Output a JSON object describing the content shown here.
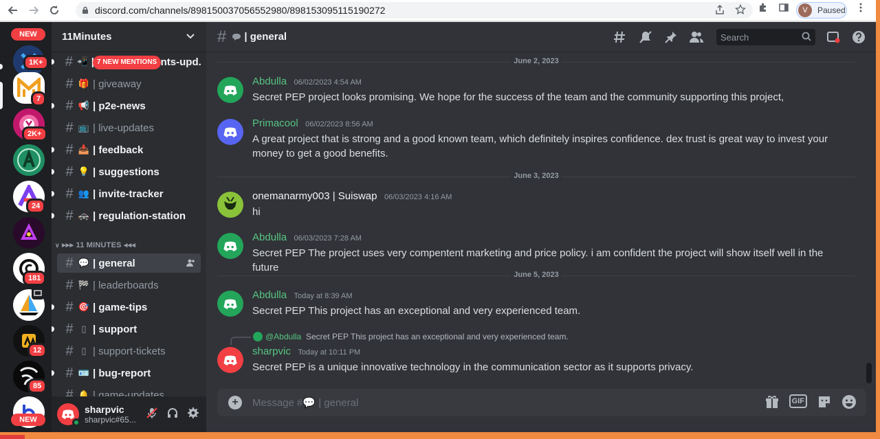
{
  "browser": {
    "url": "discord.com/channels/898150037056552980/898153095115190272",
    "profile_initial": "V",
    "profile_status": "Paused"
  },
  "servers": {
    "new_top": "NEW",
    "new_bottom": "NEW",
    "badges": [
      "1K+",
      "7",
      "2K+",
      "24",
      "181",
      "12",
      "85"
    ]
  },
  "guild": {
    "name": "11Minutes",
    "new_mentions": "7 NEW MENTIONS",
    "category": "▸▸▸ 11 MINUTES ◂◂◂",
    "channels": [
      {
        "name": "| announcements-upd...",
        "emoji": "📲",
        "state": "unread"
      },
      {
        "name": "| giveaway",
        "emoji": "🎁",
        "state": "read"
      },
      {
        "name": "| p2e-news",
        "emoji": "📢",
        "state": "unread"
      },
      {
        "name": "| live-updates",
        "emoji": "📺",
        "state": "read"
      },
      {
        "name": "| feedback",
        "emoji": "📥",
        "state": "unread"
      },
      {
        "name": "| suggestions",
        "emoji": "💡",
        "state": "unread"
      },
      {
        "name": "| invite-tracker",
        "emoji": "👥",
        "state": "unread"
      },
      {
        "name": "| regulation-station",
        "emoji": "🚓",
        "state": "unread"
      },
      {
        "name": "| general",
        "emoji": "💬",
        "state": "active"
      },
      {
        "name": "| leaderboards",
        "emoji": "🏁",
        "state": "read"
      },
      {
        "name": "| game-tips",
        "emoji": "🎯",
        "state": "unread"
      },
      {
        "name": "| support",
        "emoji": "▯",
        "state": "unread"
      },
      {
        "name": "| support-tickets",
        "emoji": "▯",
        "state": "read"
      },
      {
        "name": "| bug-report",
        "emoji": "🪪",
        "state": "unread"
      },
      {
        "name": "| game-updates",
        "emoji": "🔔",
        "state": "read"
      }
    ]
  },
  "user": {
    "display": "sharpvic",
    "tag": "sharpvic#65..."
  },
  "chat": {
    "channel_title": "| general",
    "search_placeholder": "Search",
    "composer_placeholder": "Message #💬 | general",
    "gif_label": "GIF",
    "dividers": [
      "June 2, 2023",
      "June 3, 2023",
      "June 5, 2023"
    ],
    "messages": [
      {
        "author": "Abdulla",
        "time": "06/02/2023 4:54 AM",
        "color": "#57c481",
        "avatar": "#23a55a",
        "body": "Secret PEP project looks promising. We hope for the success of the team and the community supporting this project,"
      },
      {
        "author": "Primacool",
        "time": "06/02/2023 8:56 AM",
        "color": "#57c481",
        "avatar": "#5865f2",
        "body": "A great project that is strong and a good known team, which definitely inspires confidence. dex trust is great way to invest your money to get a good benefits."
      },
      {
        "author": "onemanarmy003 | Suiswap",
        "time": "06/03/2023 4:16 AM",
        "color": "#f2f3f5",
        "avatar": "#4a7a28",
        "body": "hi"
      },
      {
        "author": "Abdulla",
        "time": "06/03/2023 7:28 AM",
        "color": "#57c481",
        "avatar": "#23a55a",
        "body": "Secret PEP The project uses very compentent marketing and price policy. i am confident the project will show itself well in the future"
      },
      {
        "author": "Abdulla",
        "time": "Today at 8:39 AM",
        "color": "#57c481",
        "avatar": "#23a55a",
        "body": "Secret PEP This project has an exceptional and very experienced team."
      },
      {
        "author": "sharpvic",
        "time": "Today at 10:11 PM",
        "color": "#57c481",
        "avatar": "#f23f43",
        "body": "Secret PEP is a unique innovative technology in the communication sector as it supports privacy."
      }
    ],
    "reply": {
      "name": "@Abdulla",
      "text": "Secret PEP This project has an exceptional and very experienced team."
    }
  }
}
